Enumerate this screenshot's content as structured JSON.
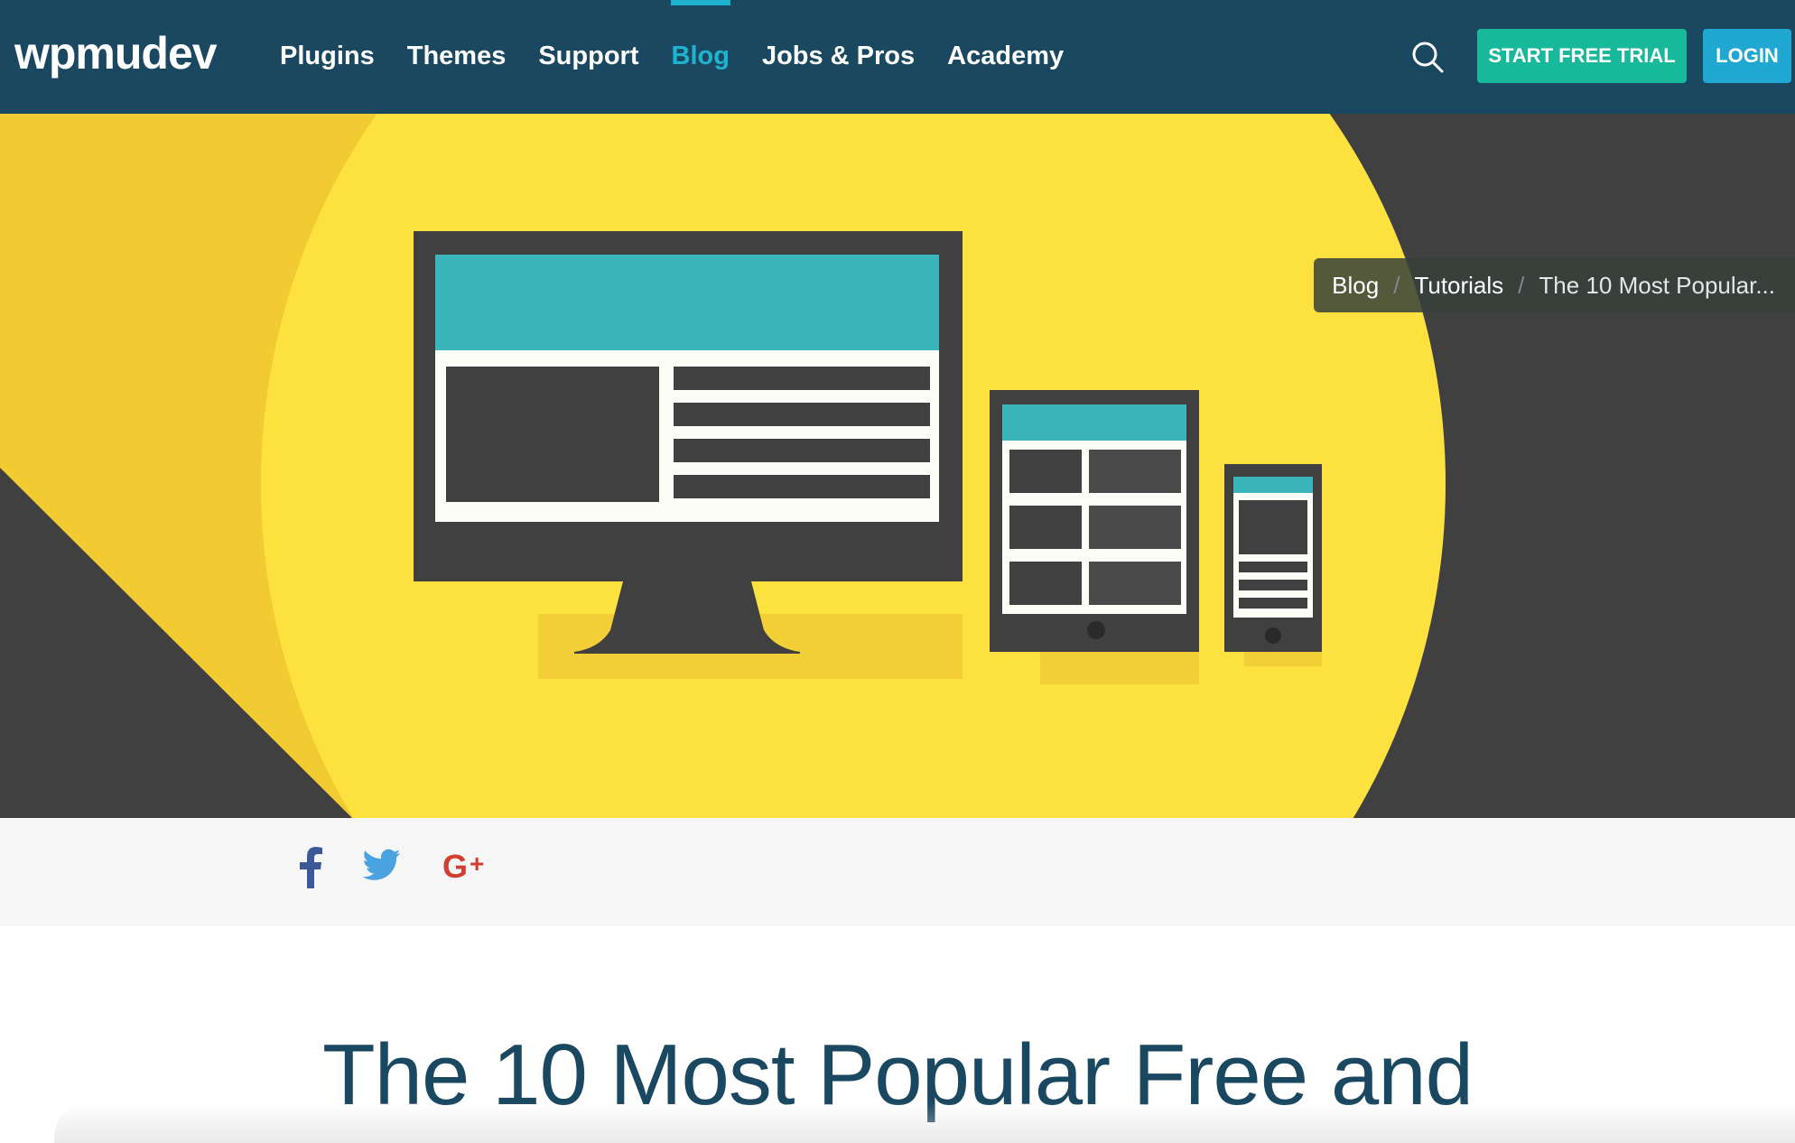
{
  "header": {
    "logo_text": "wpmudev",
    "nav": [
      {
        "label": "Plugins",
        "active": false
      },
      {
        "label": "Themes",
        "active": false
      },
      {
        "label": "Support",
        "active": false
      },
      {
        "label": "Blog",
        "active": true
      },
      {
        "label": "Jobs & Pros",
        "active": false
      },
      {
        "label": "Academy",
        "active": false
      }
    ],
    "search_icon": "search-icon",
    "trial_label": "START FREE TRIAL",
    "login_label": "LOGIN"
  },
  "breadcrumb": {
    "items": [
      "Blog",
      "Tutorials"
    ],
    "current": "The 10 Most Popular..."
  },
  "share": {
    "icons": [
      "facebook-icon",
      "twitter-icon",
      "google-plus-icon"
    ]
  },
  "article": {
    "title": "The 10 Most Popular Free and"
  },
  "colors": {
    "header_bg": "#1a4860",
    "accent": "#20b3cf",
    "trial_button": "#18b89a",
    "login_button": "#20a8d3",
    "hero_yellow": "#fde23f",
    "hero_dark": "#404040",
    "hero_teal": "#3ab6bb"
  }
}
